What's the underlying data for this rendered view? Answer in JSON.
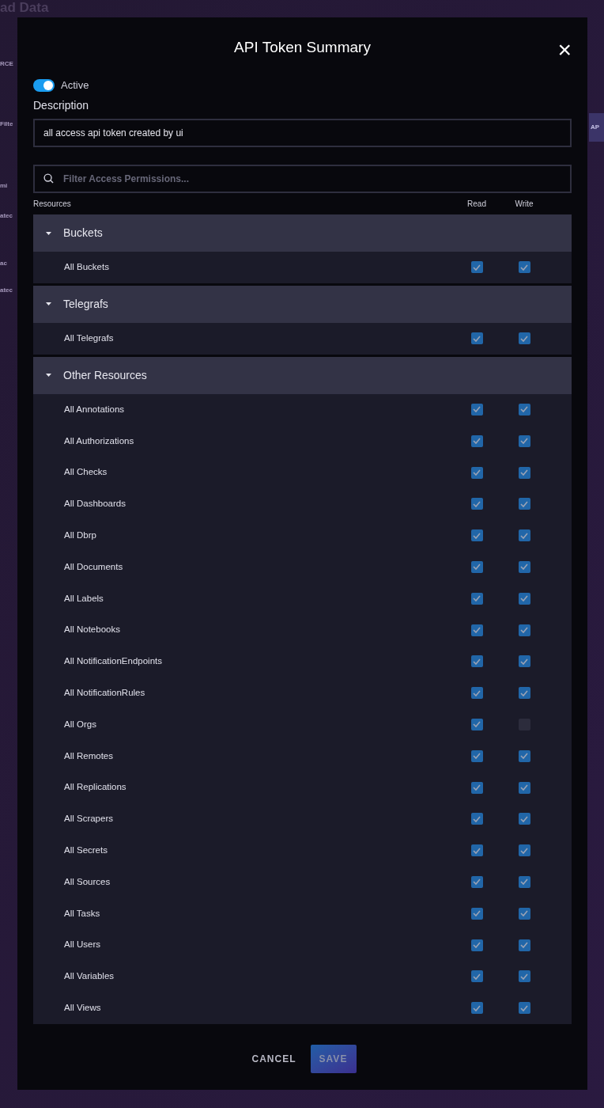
{
  "background": {
    "heading": "ad Data",
    "left_texts": [
      "RCE",
      "Filte",
      "mi",
      "atec",
      "ac",
      "atec"
    ],
    "right_button": "AP"
  },
  "modal": {
    "title": "API Token Summary",
    "close": "×",
    "active": {
      "label": "Active",
      "on": true
    },
    "description": {
      "label": "Description",
      "value": "all access api token created by ui"
    },
    "filter": {
      "placeholder": "Filter Access Permissions..."
    },
    "columns": {
      "resources": "Resources",
      "read": "Read",
      "write": "Write"
    },
    "groups": [
      {
        "name": "Buckets",
        "expanded": true,
        "items": [
          {
            "name": "All Buckets",
            "read": true,
            "write": true
          }
        ]
      },
      {
        "name": "Telegrafs",
        "expanded": true,
        "items": [
          {
            "name": "All Telegrafs",
            "read": true,
            "write": true
          }
        ]
      },
      {
        "name": "Other Resources",
        "expanded": true,
        "items": [
          {
            "name": "All Annotations",
            "read": true,
            "write": true
          },
          {
            "name": "All Authorizations",
            "read": true,
            "write": true
          },
          {
            "name": "All Checks",
            "read": true,
            "write": true
          },
          {
            "name": "All Dashboards",
            "read": true,
            "write": true
          },
          {
            "name": "All Dbrp",
            "read": true,
            "write": true
          },
          {
            "name": "All Documents",
            "read": true,
            "write": true
          },
          {
            "name": "All Labels",
            "read": true,
            "write": true
          },
          {
            "name": "All Notebooks",
            "read": true,
            "write": true
          },
          {
            "name": "All NotificationEndpoints",
            "read": true,
            "write": true
          },
          {
            "name": "All NotificationRules",
            "read": true,
            "write": true
          },
          {
            "name": "All Orgs",
            "read": true,
            "write": false
          },
          {
            "name": "All Remotes",
            "read": true,
            "write": true
          },
          {
            "name": "All Replications",
            "read": true,
            "write": true
          },
          {
            "name": "All Scrapers",
            "read": true,
            "write": true
          },
          {
            "name": "All Secrets",
            "read": true,
            "write": true
          },
          {
            "name": "All Sources",
            "read": true,
            "write": true
          },
          {
            "name": "All Tasks",
            "read": true,
            "write": true
          },
          {
            "name": "All Users",
            "read": true,
            "write": true
          },
          {
            "name": "All Variables",
            "read": true,
            "write": true
          },
          {
            "name": "All Views",
            "read": true,
            "write": true
          }
        ]
      }
    ],
    "buttons": {
      "cancel": "CANCEL",
      "save": {
        "label": "SAVE",
        "disabled": true
      }
    }
  }
}
